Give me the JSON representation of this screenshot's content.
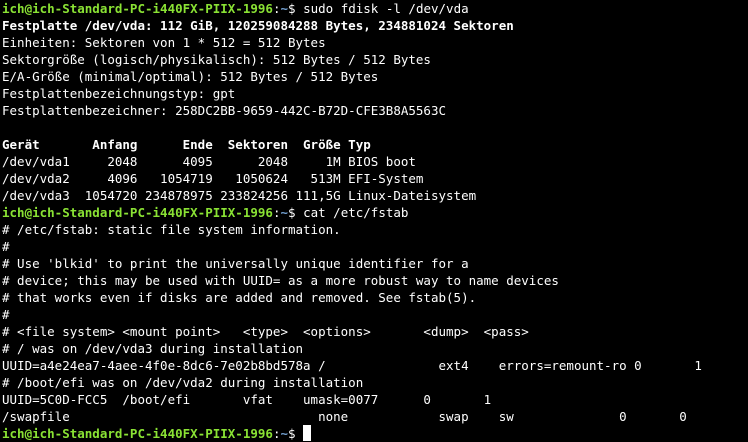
{
  "prompt": {
    "user_host": "ich@ich-Standard-PC-i440FX-PIIX-1996",
    "path": "~",
    "symbol": "$ ",
    "user_color": "#8ae234",
    "path_color": "#729fcf"
  },
  "commands": {
    "fdisk": "sudo fdisk -l /dev/vda",
    "cat": "cat /etc/fstab"
  },
  "fdisk": {
    "disk_line": "Festplatte /dev/vda: 112 GiB, 120259084288 Bytes, 234881024 Sektoren",
    "info": [
      "Einheiten: Sektoren von 1 * 512 = 512 Bytes",
      "Sektorgröße (logisch/physikalisch): 512 Bytes / 512 Bytes",
      "E/A-Größe (minimal/optimal): 512 Bytes / 512 Bytes",
      "Festplattenbezeichnungstyp: gpt",
      "Festplattenbezeichner: 258DC2BB-9659-442C-B72D-CFE3B8A5563C"
    ],
    "table_header": "Gerät       Anfang      Ende  Sektoren  Größe Typ",
    "table_rows": [
      "/dev/vda1     2048      4095      2048     1M BIOS boot",
      "/dev/vda2     4096   1054719   1050624   513M EFI-System",
      "/dev/vda3  1054720 234878975 233824256 111,5G Linux-Dateisystem"
    ]
  },
  "fstab": [
    "# /etc/fstab: static file system information.",
    "#",
    "# Use 'blkid' to print the universally unique identifier for a",
    "# device; this may be used with UUID= as a more robust way to name devices",
    "# that works even if disks are added and removed. See fstab(5).",
    "#",
    "# <file system> <mount point>   <type>  <options>       <dump>  <pass>",
    "# / was on /dev/vda3 during installation",
    "UUID=a4e24ea7-4aee-4f0e-8dc6-7e02b8bd578a /               ext4    errors=remount-ro 0       1",
    "# /boot/efi was on /dev/vda2 during installation",
    "UUID=5C0D-FCC5  /boot/efi       vfat    umask=0077      0       1",
    "/swapfile                                 none            swap    sw              0       0"
  ]
}
